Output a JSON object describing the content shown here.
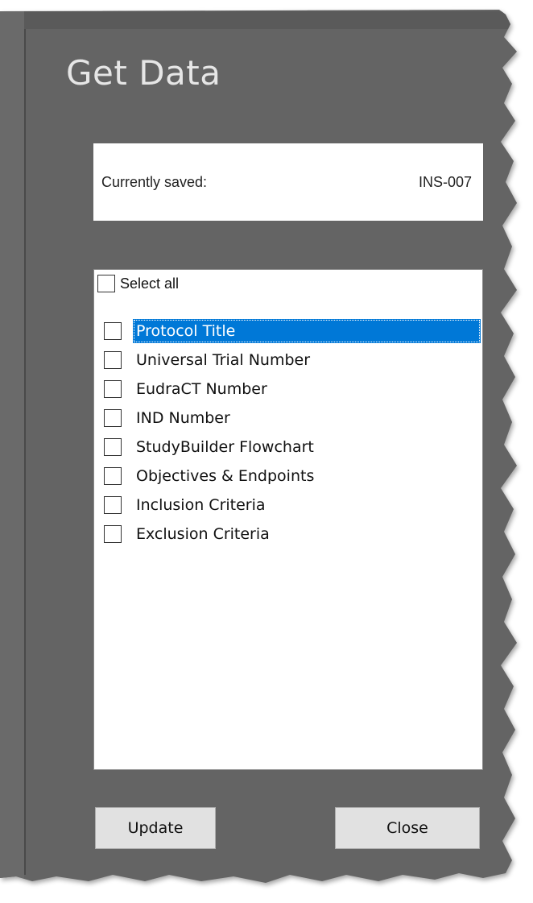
{
  "dialog": {
    "title": "Get Data"
  },
  "saved": {
    "label": "Currently saved:",
    "value": "INS-007"
  },
  "list": {
    "select_all_label": "Select all",
    "items": [
      {
        "label": "Protocol Title",
        "checked": false,
        "selected": true
      },
      {
        "label": "Universal Trial Number",
        "checked": false,
        "selected": false
      },
      {
        "label": "EudraCT Number",
        "checked": false,
        "selected": false
      },
      {
        "label": "IND Number",
        "checked": false,
        "selected": false
      },
      {
        "label": "StudyBuilder Flowchart",
        "checked": false,
        "selected": false
      },
      {
        "label": "Objectives & Endpoints",
        "checked": false,
        "selected": false
      },
      {
        "label": "Inclusion Criteria",
        "checked": false,
        "selected": false
      },
      {
        "label": "Exclusion Criteria",
        "checked": false,
        "selected": false
      }
    ]
  },
  "buttons": {
    "update_label": "Update",
    "close_label": "Close"
  },
  "colors": {
    "background": "#646464",
    "selection": "#0078d7",
    "button_face": "#e1e1e1"
  }
}
